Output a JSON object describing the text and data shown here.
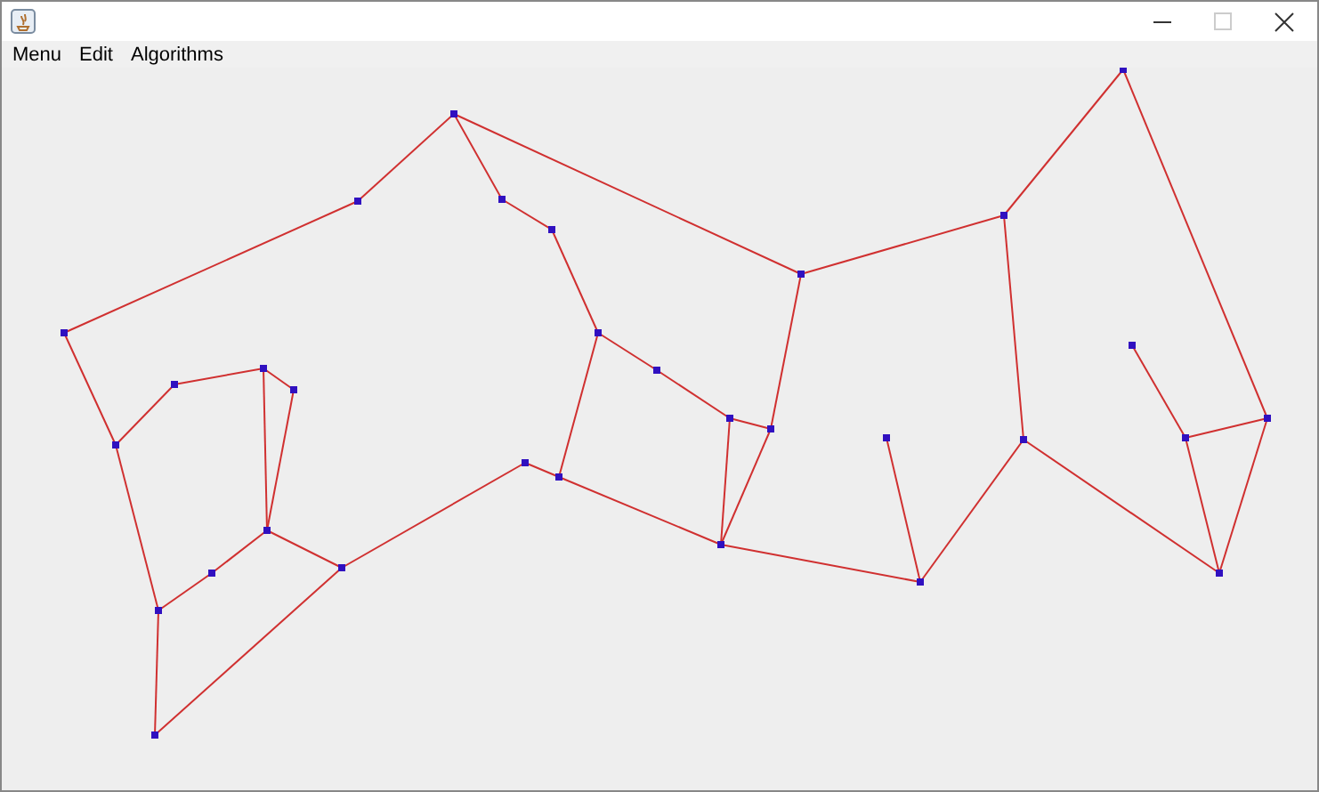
{
  "window": {
    "maximize_disabled": true
  },
  "menu_bar": [
    {
      "label": "Menu"
    },
    {
      "label": "Edit"
    },
    {
      "label": "Algorithms"
    }
  ]
}
